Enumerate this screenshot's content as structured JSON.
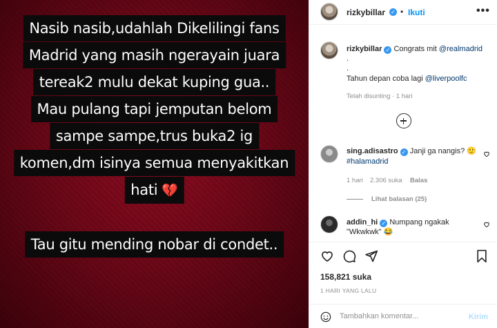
{
  "story": {
    "lines": [
      "Nasib nasib,udahlah Dikelilingi fans",
      "Madrid yang masih ngerayain juara",
      "tereak2 mulu dekat kuping gua..",
      "Mau pulang tapi jemputan belom",
      "sampe sampe,trus buka2 ig",
      "komen,dm isinya semua menyakitkan",
      "hati",
      "Tau gitu mending nobar di condet.."
    ],
    "heart_emoji": "💔"
  },
  "header": {
    "username": "rizkybillar",
    "separator": "•",
    "follow_label": "Ikuti",
    "more_label": "•••"
  },
  "caption": {
    "username": "rizkybillar",
    "text_before": "Congrats mit ",
    "mention1": "@realmadrid",
    "dot1": ".",
    "dot2": ".",
    "line2_before": "Tahun depan coba lagi ",
    "mention2": "@liverpoolfc",
    "meta": "Telah disunting · 1 hari"
  },
  "comments": [
    {
      "username": "sing.adisastro",
      "text": "Janji ga nangis? 🙂",
      "hashtag": "#halamadrid",
      "time": "1 hari",
      "likes": "2.306 suka",
      "reply": "Balas",
      "view_replies": "Lihat balasan (25)"
    },
    {
      "username": "addin_hi",
      "text": "Numpang ngakak",
      "text2": "\"Wkwkwk\" 😂"
    }
  ],
  "post": {
    "likes": "158,821 suka",
    "time_ago": "1 HARI YANG LALU"
  },
  "comment_box": {
    "placeholder": "Tambahkan komentar...",
    "post_label": "Kirim"
  }
}
